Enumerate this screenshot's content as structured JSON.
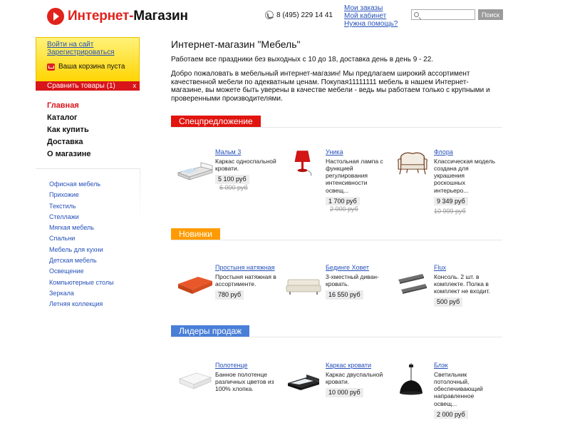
{
  "header": {
    "logo_part1": "Интернет-",
    "logo_part2": "Магазин",
    "phone": "8 (495) 229 14 41",
    "links": [
      "Мои заказы",
      "Мой кабинет",
      "Нужна помощь?"
    ],
    "search_placeholder": "",
    "search_button": "Поиск"
  },
  "sidebar": {
    "login": "Войти на сайт",
    "register": "Зарегистрироваться",
    "cart": "Ваша корзина пуста",
    "compare": "Сравнить товары (1)",
    "compare_close": "x",
    "main_nav": [
      "Главная",
      "Каталог",
      "Как купить",
      "Доставка",
      "О магазине"
    ],
    "categories": [
      "Офисная мебель",
      "Прихожие",
      "Текстиль",
      "Стеллажи",
      "Мягкая мебель",
      "Спальни",
      "Мебель для кухни",
      "Детская мебель",
      "Освещение",
      "Компьютерные столы",
      "Зеркала",
      "Летняя коллекция"
    ]
  },
  "main": {
    "title": "Интернет-магазин \"Мебель\"",
    "paragraph1": "Работаем все праздники без выходных с 10 до 18, доставка день в день 9 - 22.",
    "paragraph2": "Добро пожаловать в мебельный интернет-магазин! Мы предлагаем широкий ассортимент качественной мебели по адекватным ценам. Покупая11111111 мебель в нашем Интернет-магазине, вы можете быть уверены в качестве мебели - ведь мы работаем только с крупными и проверенными производителями."
  },
  "sections": [
    {
      "title": "Спецпредложение",
      "color": "#e1140f",
      "products": [
        {
          "name": "Мальм 3",
          "desc": "Каркас односпальной кровати.",
          "price": "5 100 руб",
          "old_price": "6 000 руб"
        },
        {
          "name": "Уника",
          "desc": "Настольная лампа с функцией регулирования интенсивности освещ...",
          "price": "1 700 руб",
          "old_price": "2 000 руб"
        },
        {
          "name": "Флора",
          "desc": "Классическая модель создана для украшения роскошных интерьеро...",
          "price": "9 349 руб",
          "old_price": "10 999 руб"
        }
      ]
    },
    {
      "title": "Новинки",
      "color": "#ff9b00",
      "products": [
        {
          "name": "Простыня натяжная",
          "desc": "Простыня натяжная в ассортименте.",
          "price": "780 руб",
          "old_price": ""
        },
        {
          "name": "Бединге Ховет",
          "desc": "3-хместный диван-кровать.",
          "price": "16 550 руб",
          "old_price": ""
        },
        {
          "name": "Flux",
          "desc": "Консоль. 2 шт. в комплекте. Полка в комплект не входит.",
          "price": "500 руб",
          "old_price": ""
        }
      ]
    },
    {
      "title": "Лидеры продаж",
      "color": "#4a7fd8",
      "products": [
        {
          "name": "Полотенце",
          "desc": "Банное полотенце различных цветов из 100% хлопка.",
          "price": "",
          "old_price": ""
        },
        {
          "name": "Каркас кровати",
          "desc": "Каркас двуспальной кровати.",
          "price": "10 000 руб",
          "old_price": ""
        },
        {
          "name": "Блэк",
          "desc": "Светильник потолочный, обеспечивающий направленное освещ...",
          "price": "2 000 руб",
          "old_price": ""
        }
      ]
    }
  ]
}
